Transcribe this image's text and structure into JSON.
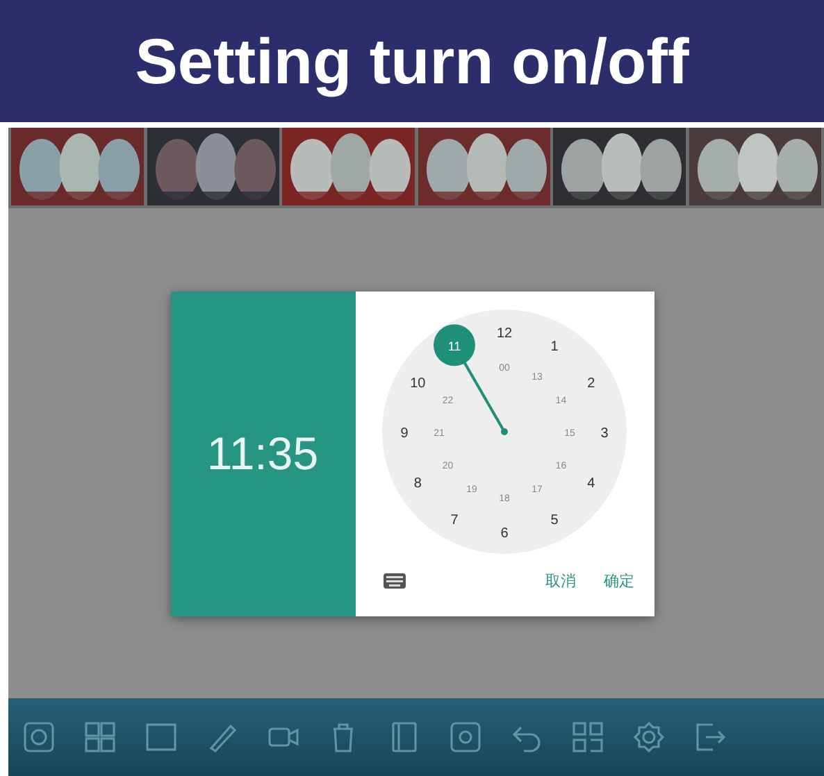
{
  "banner": {
    "title": "Setting turn on/off"
  },
  "time_dialog": {
    "time": "11:35",
    "hours": [
      {
        "label": "12",
        "selected": false
      },
      {
        "label": "1",
        "selected": false
      },
      {
        "label": "2",
        "selected": false
      },
      {
        "label": "3",
        "selected": false
      },
      {
        "label": "4",
        "selected": false
      },
      {
        "label": "5",
        "selected": false
      },
      {
        "label": "6",
        "selected": false
      },
      {
        "label": "7",
        "selected": false
      },
      {
        "label": "8",
        "selected": false
      },
      {
        "label": "9",
        "selected": false
      },
      {
        "label": "10",
        "selected": false
      },
      {
        "label": "11",
        "selected": true
      }
    ],
    "inner_hours": [
      "00",
      "13",
      "14",
      "15",
      "16",
      "17",
      "18",
      "19",
      "20",
      "21",
      "22"
    ],
    "buttons": [
      "取消",
      "确定"
    ]
  }
}
